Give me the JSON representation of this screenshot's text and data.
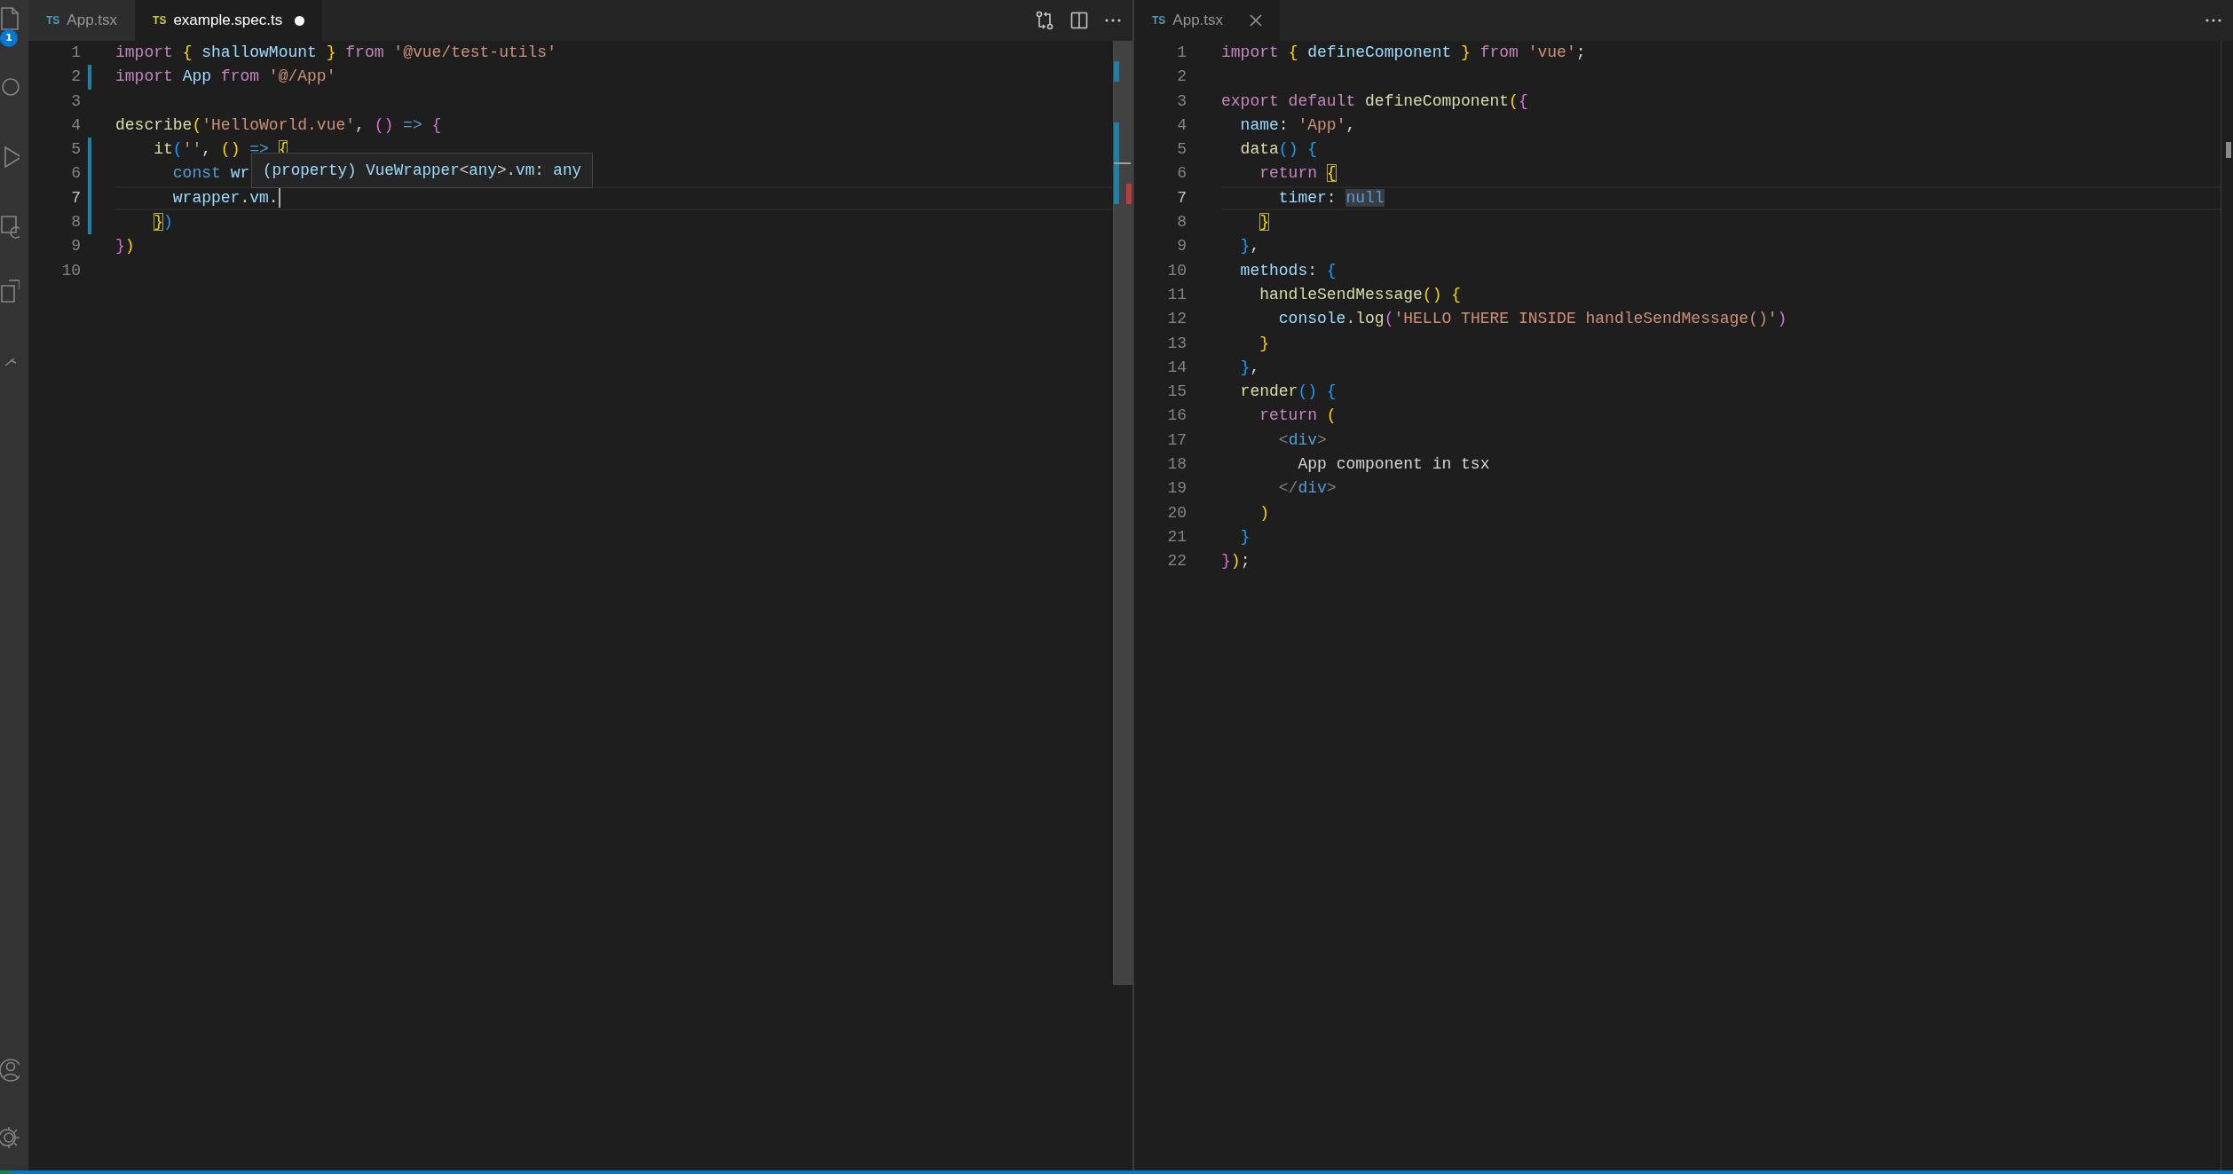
{
  "activity_bar": {
    "badge": "1"
  },
  "groups": [
    {
      "focused": true,
      "tabs": [
        {
          "badge": "TS",
          "color": "#519aba",
          "label": "App.tsx",
          "selected": false,
          "modified": false
        },
        {
          "badge": "TS",
          "color": "#cbcb41",
          "label": "example.spec.ts",
          "selected": true,
          "modified": true
        }
      ],
      "lines": [
        {
          "n": "1",
          "changed": false,
          "current": false,
          "tokens": [
            {
              "text": "import ",
              "kind": "kw"
            },
            {
              "text": "{",
              "kind": "b1"
            },
            {
              "text": " shallowMount ",
              "kind": "var"
            },
            {
              "text": "}",
              "kind": "b1"
            },
            {
              "text": " from ",
              "kind": "kw"
            },
            {
              "text": "'@vue/test-utils'",
              "kind": "str"
            }
          ]
        },
        {
          "n": "2",
          "changed": true,
          "current": false,
          "tokens": [
            {
              "text": "import",
              "kind": "kw"
            },
            {
              "text": " App ",
              "kind": "var"
            },
            {
              "text": "from ",
              "kind": "kw"
            },
            {
              "text": "'@/App'",
              "kind": "str"
            }
          ]
        },
        {
          "n": "3",
          "changed": false,
          "current": false
        },
        {
          "n": "4",
          "changed": false,
          "current": false,
          "tokens": [
            {
              "text": "describe",
              "kind": "fn"
            },
            {
              "text": "(",
              "kind": "b1"
            },
            {
              "text": "'HelloWorld.vue'",
              "kind": "str"
            },
            {
              "text": ", ",
              "kind": "plain"
            },
            {
              "text": "() ",
              "kind": "b2"
            },
            {
              "text": "=> ",
              "kind": "const"
            },
            {
              "text": "{",
              "kind": "b2"
            }
          ]
        },
        {
          "n": "5",
          "changed": true,
          "current": false,
          "tokens": [
            {
              "text": "    it",
              "kind": "fn"
            },
            {
              "text": "(",
              "kind": "b3"
            },
            {
              "text": "''",
              "kind": "str"
            },
            {
              "text": ", ",
              "kind": "plain"
            },
            {
              "text": "() ",
              "kind": "b1"
            },
            {
              "text": "=> ",
              "kind": "const"
            },
            {
              "text": "{",
              "kind": "b1_match"
            }
          ]
        },
        {
          "n": "6",
          "changed": true,
          "current": false,
          "tokens": [
            {
              "text": "      const",
              "kind": "const"
            },
            {
              "text": " wr",
              "kind": "var"
            }
          ]
        },
        {
          "n": "7",
          "changed": true,
          "current": true,
          "tokens": [
            {
              "text": "      wrapper",
              "kind": "var"
            },
            {
              "text": ".",
              "kind": "plain"
            },
            {
              "text": "vm",
              "kind": "var"
            },
            {
              "text": ".",
              "kind": "plain"
            }
          ]
        },
        {
          "n": "8",
          "changed": true,
          "current": false,
          "tokens": [
            {
              "text": "    }",
              "kind": "b1_match"
            },
            {
              "text": ")",
              "kind": "b3"
            }
          ]
        },
        {
          "n": "9",
          "changed": false,
          "current": false,
          "tokens": [
            {
              "text": "}",
              "kind": "b2"
            },
            {
              "text": ")",
              "kind": "b1"
            }
          ]
        },
        {
          "n": "10",
          "changed": false,
          "current": false
        }
      ],
      "hover": [
        {
          "text": "(property) VueWrapper",
          "kind": "var"
        },
        {
          "text": "<",
          "kind": "plain"
        },
        {
          "text": "any",
          "kind": "var"
        },
        {
          "text": ">.",
          "kind": "plain"
        },
        {
          "text": "vm",
          "kind": "var"
        },
        {
          "text": ": ",
          "kind": "plain"
        },
        {
          "text": "any",
          "kind": "var"
        }
      ]
    },
    {
      "focused": false,
      "tabs": [
        {
          "badge": "TS",
          "color": "#519aba",
          "label": "App.tsx",
          "selected": true,
          "modified": false
        }
      ],
      "lines": [
        {
          "n": "1",
          "changed": false,
          "current": false,
          "tokens": [
            {
              "text": "import ",
              "kind": "kw"
            },
            {
              "text": "{",
              "kind": "b1"
            },
            {
              "text": " defineComponent ",
              "kind": "var"
            },
            {
              "text": "}",
              "kind": "b1"
            },
            {
              "text": " from ",
              "kind": "kw"
            },
            {
              "text": "'vue'",
              "kind": "str"
            },
            {
              "text": ";",
              "kind": "plain"
            }
          ]
        },
        {
          "n": "2",
          "changed": false,
          "current": false
        },
        {
          "n": "3",
          "changed": false,
          "current": false,
          "tokens": [
            {
              "text": "export default ",
              "kind": "kw"
            },
            {
              "text": "defineComponent",
              "kind": "fn"
            },
            {
              "text": "(",
              "kind": "b1"
            },
            {
              "text": "{",
              "kind": "b2"
            }
          ]
        },
        {
          "n": "4",
          "changed": false,
          "current": false,
          "tokens": [
            {
              "text": "  name",
              "kind": "var"
            },
            {
              "text": ": ",
              "kind": "plain"
            },
            {
              "text": "'App'",
              "kind": "str"
            },
            {
              "text": ",",
              "kind": "plain"
            }
          ]
        },
        {
          "n": "5",
          "changed": false,
          "current": false,
          "tokens": [
            {
              "text": "  data",
              "kind": "fn"
            },
            {
              "text": "() {",
              "kind": "b3"
            }
          ]
        },
        {
          "n": "6",
          "changed": false,
          "current": false,
          "tokens": [
            {
              "text": "    return ",
              "kind": "kw"
            },
            {
              "text": "{",
              "kind": "b1_match"
            }
          ]
        },
        {
          "n": "7",
          "changed": false,
          "current": true,
          "tokens": [
            {
              "text": "      timer",
              "kind": "var"
            },
            {
              "text": ": ",
              "kind": "plain"
            },
            {
              "text": "null",
              "kind": "const_selected"
            }
          ]
        },
        {
          "n": "8",
          "changed": false,
          "current": false,
          "tokens": [
            {
              "text": "    }",
              "kind": "b1_match"
            }
          ]
        },
        {
          "n": "9",
          "changed": false,
          "current": false,
          "tokens": [
            {
              "text": "  }",
              "kind": "b3"
            },
            {
              "text": ",",
              "kind": "plain"
            }
          ]
        },
        {
          "n": "10",
          "changed": false,
          "current": false,
          "tokens": [
            {
              "text": "  methods",
              "kind": "var"
            },
            {
              "text": ": ",
              "kind": "plain"
            },
            {
              "text": "{",
              "kind": "b3"
            }
          ]
        },
        {
          "n": "11",
          "changed": false,
          "current": false,
          "tokens": [
            {
              "text": "    handleSendMessage",
              "kind": "fn"
            },
            {
              "text": "() {",
              "kind": "b1"
            }
          ]
        },
        {
          "n": "12",
          "changed": false,
          "current": false,
          "tokens": [
            {
              "text": "      console",
              "kind": "var"
            },
            {
              "text": ".",
              "kind": "plain"
            },
            {
              "text": "log",
              "kind": "fn"
            },
            {
              "text": "(",
              "kind": "b2"
            },
            {
              "text": "'HELLO THERE INSIDE handleSendMessage()'",
              "kind": "str"
            },
            {
              "text": ")",
              "kind": "b2"
            }
          ]
        },
        {
          "n": "13",
          "changed": false,
          "current": false,
          "tokens": [
            {
              "text": "    }",
              "kind": "b1"
            }
          ]
        },
        {
          "n": "14",
          "changed": false,
          "current": false,
          "tokens": [
            {
              "text": "  }",
              "kind": "b3"
            },
            {
              "text": ",",
              "kind": "plain"
            }
          ]
        },
        {
          "n": "15",
          "changed": false,
          "current": false,
          "tokens": [
            {
              "text": "  render",
              "kind": "fn"
            },
            {
              "text": "() {",
              "kind": "b3"
            }
          ]
        },
        {
          "n": "16",
          "changed": false,
          "current": false,
          "tokens": [
            {
              "text": "    return ",
              "kind": "kw"
            },
            {
              "text": "(",
              "kind": "b1"
            }
          ]
        },
        {
          "n": "17",
          "changed": false,
          "current": false,
          "tokens": [
            {
              "text": "      <",
              "kind": "tag"
            },
            {
              "text": "div",
              "kind": "const"
            },
            {
              "text": ">",
              "kind": "tag"
            }
          ]
        },
        {
          "n": "18",
          "changed": false,
          "current": false,
          "tokens": [
            {
              "text": "        App component in tsx",
              "kind": "plain"
            }
          ]
        },
        {
          "n": "19",
          "changed": false,
          "current": false,
          "tokens": [
            {
              "text": "      </",
              "kind": "tag"
            },
            {
              "text": "div",
              "kind": "const"
            },
            {
              "text": ">",
              "kind": "tag"
            }
          ]
        },
        {
          "n": "20",
          "changed": false,
          "current": false,
          "tokens": [
            {
              "text": "    )",
              "kind": "b1"
            }
          ]
        },
        {
          "n": "21",
          "changed": false,
          "current": false,
          "tokens": [
            {
              "text": "  }",
              "kind": "b3"
            }
          ]
        },
        {
          "n": "22",
          "changed": false,
          "current": false,
          "tokens": [
            {
              "text": "}",
              "kind": "b2"
            },
            {
              "text": ")",
              "kind": "b1"
            },
            {
              "text": ";",
              "kind": "plain"
            }
          ]
        }
      ]
    }
  ]
}
